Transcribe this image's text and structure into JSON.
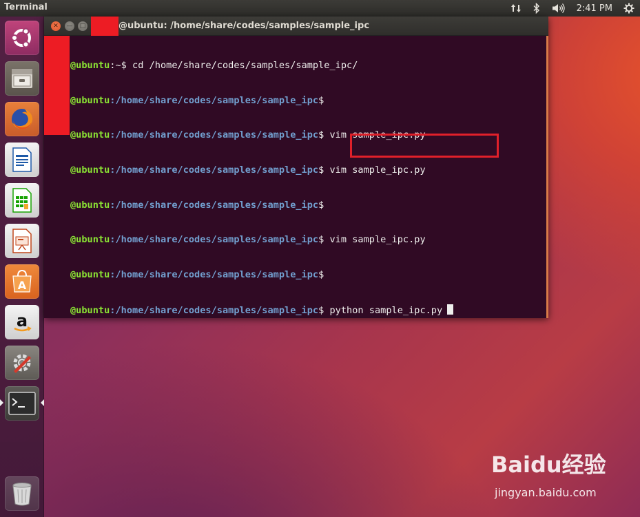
{
  "top_panel": {
    "app_title": "Terminal",
    "time": "2:41 PM",
    "icons": [
      "network-updown-icon",
      "bluetooth-icon",
      "volume-icon",
      "power-gear-icon"
    ]
  },
  "launcher": {
    "items": [
      {
        "name": "ubuntu-dash-icon"
      },
      {
        "name": "files-icon"
      },
      {
        "name": "firefox-icon"
      },
      {
        "name": "libreoffice-writer-icon"
      },
      {
        "name": "libreoffice-calc-icon"
      },
      {
        "name": "libreoffice-impress-icon"
      },
      {
        "name": "software-center-icon"
      },
      {
        "name": "amazon-icon"
      },
      {
        "name": "system-settings-icon"
      },
      {
        "name": "terminal-icon"
      },
      {
        "name": "trash-icon"
      }
    ]
  },
  "terminal": {
    "title": "@ubuntu: /home/share/codes/samples/sample_ipc",
    "lines": [
      {
        "user": "@ubuntu",
        "path": ":~",
        "cmd": "$ cd /home/share/codes/samples/sample_ipc/"
      },
      {
        "user": "@ubuntu",
        "path": ":/home/share/codes/samples/sample_ipc",
        "cmd": "$"
      },
      {
        "user": "@ubuntu",
        "path": ":/home/share/codes/samples/sample_ipc",
        "cmd": "$ vim sample_ipc.py"
      },
      {
        "user": "@ubuntu",
        "path": ":/home/share/codes/samples/sample_ipc",
        "cmd": "$ vim sample_ipc.py"
      },
      {
        "user": "@ubuntu",
        "path": ":/home/share/codes/samples/sample_ipc",
        "cmd": "$"
      },
      {
        "user": "@ubuntu",
        "path": ":/home/share/codes/samples/sample_ipc",
        "cmd": "$ vim sample_ipc.py"
      },
      {
        "user": "@ubuntu",
        "path": ":/home/share/codes/samples/sample_ipc",
        "cmd": "$"
      },
      {
        "user": "@ubuntu",
        "path": ":/home/share/codes/samples/sample_ipc",
        "cmd": "$ python sample_ipc.py"
      }
    ]
  },
  "watermark": {
    "logo": "Baidu经验",
    "url": "jingyan.baidu.com"
  },
  "colors": {
    "prompt_user": "#8ae234",
    "prompt_path": "#729fcf",
    "terminal_bg": "#300a24",
    "highlight": "#e0202a",
    "redaction": "#ed1c24"
  }
}
